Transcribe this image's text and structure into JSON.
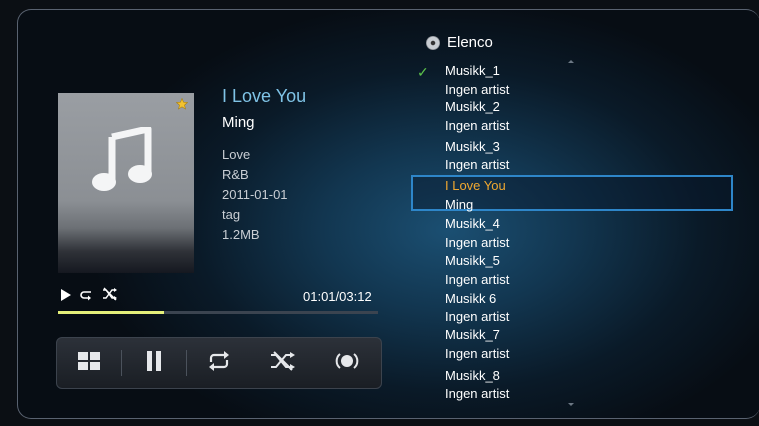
{
  "now_playing": {
    "title": "I Love You",
    "artist": "Ming",
    "album": "Love",
    "genre": "R&B",
    "date": "2011-01-01",
    "tag": "tag",
    "size": "1.2MB",
    "time": "01:01/03:12",
    "progress_fraction": 0.33
  },
  "control_bar": {
    "buttons": [
      "grid-icon",
      "pause-icon",
      "repeat-icon",
      "shuffle-icon",
      "sound-mode-icon"
    ]
  },
  "playlist": {
    "title": "Elenco",
    "items": [
      {
        "title": "Musikk_1",
        "artist": "Ingen artist",
        "checked": true
      },
      {
        "title": "Musikk_2",
        "artist": "Ingen artist"
      },
      {
        "title": "Musikk_3",
        "artist": "Ingen artist"
      },
      {
        "title": "I Love You",
        "artist": "Ming",
        "selected": true
      },
      {
        "title": "Musikk_4",
        "artist": "Ingen artist"
      },
      {
        "title": "Musikk_5",
        "artist": "Ingen artist"
      },
      {
        "title": "Musikk  6",
        "artist": "Ingen artist"
      },
      {
        "title": "Musikk_7",
        "artist": "Ingen artist"
      },
      {
        "title": "Musikk_8",
        "artist": "Ingen artist"
      }
    ]
  },
  "colors": {
    "title": "#7fc3e6",
    "selected_text": "#f0a830",
    "progress": "#e4ef7a",
    "selection_border": "#2e86c9"
  }
}
